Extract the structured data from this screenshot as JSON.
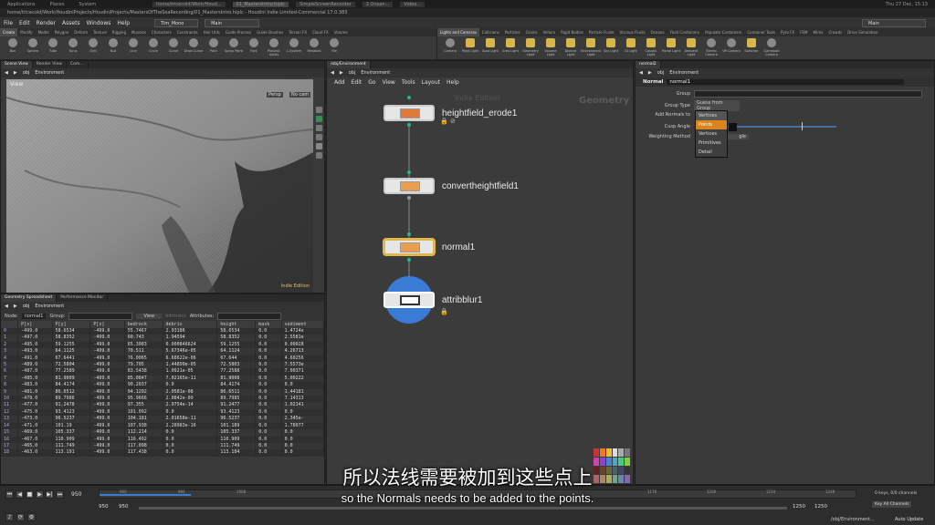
{
  "os_bar": {
    "items": [
      "Applications",
      "Places",
      "System"
    ],
    "tasks": [
      "home/tricecold/Work/Houd...",
      "01_MastersIntro.hiplc",
      "SimpleScreenRecorder",
      "2.Ocean...",
      "Video..."
    ],
    "clock": "Thu 27 Dec, 15:13"
  },
  "window_title": "home/tricecold/Work/HoudiniProjects/HoudiniProjects/MastersOfTheSeaRecording/01_MastersIntro.hiplc - Houdini Indie Limited-Commercial 17.0.383",
  "menu": {
    "items": [
      "File",
      "Edit",
      "Render",
      "Assets",
      "Windows",
      "Help"
    ],
    "desktop": "Tim_Mono",
    "pane": "Main",
    "right_pane": "Main"
  },
  "shelf_left": {
    "tabs": [
      "Create",
      "Modify",
      "Model",
      "Polygon",
      "Deform",
      "Texture",
      "Rigging",
      "Muscles",
      "Characters",
      "Constraints",
      "Hair Utils",
      "Guide Process",
      "Guide Brushes",
      "Terrain FX",
      "Cloud FX",
      "Volume"
    ],
    "tools": [
      "Box",
      "Sphere",
      "Tube",
      "Torus",
      "Grid",
      "Null",
      "Line",
      "Circle",
      "Curve",
      "Draw Curve",
      "Path",
      "Spray Paint",
      "Font",
      "Platonic Solids",
      "L-System",
      "Metaball",
      "File"
    ]
  },
  "shelf_right": {
    "tabs": [
      "Lights and Cameras",
      "Collisions",
      "Particles",
      "Grains",
      "Vellum",
      "Rigid Bodies",
      "Particle Fluids",
      "Viscous Fluids",
      "Oceans",
      "Fluid Containers",
      "Populate Containers",
      "Container Tools",
      "Pyro FX",
      "FEM",
      "Wires",
      "Crowds",
      "Drive Simulation"
    ],
    "tools": [
      "Camera",
      "Point Light",
      "Spot Light",
      "Area Light",
      "Geometry Light",
      "Volume Light",
      "Distant Light",
      "Environment Light",
      "Sky Light",
      "GI Light",
      "Caustic Light",
      "Portal Light",
      "Ambient Light",
      "Stereo Camera",
      "VR Camera",
      "Switcher",
      "Gamepad Camera"
    ]
  },
  "scene_view": {
    "tabs": [
      "Scene View",
      "Render View",
      "Com..."
    ],
    "path": "obj",
    "node": "Environment",
    "view_label": "View",
    "persp": "Persp",
    "cam": "No cam",
    "watermark": "Indie Edition"
  },
  "spreadsheet": {
    "tabs": [
      "Geometry Spreadsheet",
      "Performance Monitor"
    ],
    "path": "obj",
    "node_path": "Environment",
    "node_label": "Node:",
    "node_value": "normal1",
    "group_label": "Group:",
    "view_label": "View",
    "intrinsics": "Intrinsics",
    "attributes_label": "Attributes:",
    "columns": [
      "",
      "P[x]",
      "P[y]",
      "P[z]",
      "bedrock",
      "debris",
      "height",
      "mask",
      "sediment"
    ],
    "rows": [
      [
        "0",
        "-499.0",
        "58.6534",
        "-499.0",
        "55.7467",
        "2.93186",
        "58.6534",
        "0.0",
        "1.4724e"
      ],
      [
        "1",
        "-497.0",
        "58.8352",
        "-499.0",
        "60.743",
        "1.94594",
        "58.8352",
        "0.0",
        "2.5581e"
      ],
      [
        "2",
        "-495.0",
        "59.1255",
        "-499.0",
        "65.3083",
        "0.000846624",
        "59.1255",
        "0.0",
        "0.00028"
      ],
      [
        "3",
        "-493.0",
        "64.1125",
        "-499.0",
        "70.511",
        "5.67346e-05",
        "64.1124",
        "0.0",
        "4.26713"
      ],
      [
        "4",
        "-491.0",
        "67.6441",
        "-499.0",
        "76.0065",
        "6.68622e-06",
        "67.644",
        "0.0",
        "4.60256"
      ],
      [
        "5",
        "-489.0",
        "72.5804",
        "-499.0",
        "79.705",
        "1.44899e-05",
        "72.5803",
        "0.0",
        "7.5573e"
      ],
      [
        "6",
        "-487.0",
        "77.2589",
        "-499.0",
        "83.5438",
        "1.0921e-05",
        "77.2588",
        "0.0",
        "7.00371"
      ],
      [
        "7",
        "-485.0",
        "81.9009",
        "-499.0",
        "85.0847",
        "7.02165e-11",
        "81.9008",
        "0.0",
        "5.00222"
      ],
      [
        "8",
        "-483.0",
        "84.4174",
        "-499.0",
        "90.2037",
        "0.0",
        "84.4174",
        "0.0",
        "0.0"
      ],
      [
        "9",
        "-481.0",
        "86.6512",
        "-499.0",
        "94.1292",
        "2.0581e-08",
        "86.6511",
        "0.0",
        "1.44181"
      ],
      [
        "10",
        "-479.0",
        "89.7986",
        "-499.0",
        "95.9666",
        "2.0842e-09",
        "89.7985",
        "0.0",
        "7.14313"
      ],
      [
        "11",
        "-477.0",
        "91.2478",
        "-499.0",
        "97.355",
        "2.9754e-14",
        "91.2477",
        "0.0",
        "1.02141"
      ],
      [
        "12",
        "-475.0",
        "93.4123",
        "-499.0",
        "101.092",
        "0.0",
        "93.4123",
        "0.0",
        "0.0"
      ],
      [
        "13",
        "-473.0",
        "96.5237",
        "-499.0",
        "104.181",
        "2.01658e-11",
        "96.5237",
        "0.0",
        "2.345e-"
      ],
      [
        "14",
        "-471.0",
        "101.19",
        "-499.0",
        "107.938",
        "2.28983e-16",
        "101.189",
        "0.0",
        "1.78077"
      ],
      [
        "15",
        "-469.0",
        "105.337",
        "-499.0",
        "112.214",
        "0.0",
        "105.337",
        "0.0",
        "0.0"
      ],
      [
        "16",
        "-467.0",
        "110.909",
        "-499.0",
        "116.492",
        "0.0",
        "110.909",
        "0.0",
        "0.0"
      ],
      [
        "17",
        "-465.0",
        "111.749",
        "-499.0",
        "117.098",
        "0.0",
        "111.749",
        "0.0",
        "0.0"
      ],
      [
        "18",
        "-463.0",
        "113.191",
        "-499.0",
        "117.438",
        "0.0",
        "113.184",
        "0.0",
        "0.0"
      ]
    ]
  },
  "network": {
    "tabs": [
      "/obj/Environment"
    ],
    "path": "obj",
    "node": "Environment",
    "menus": [
      "Add",
      "Edit",
      "Go",
      "View",
      "Tools",
      "Layout",
      "Help"
    ],
    "watermark": "Indie Edition",
    "context": "Geometry",
    "nodes": [
      {
        "name": "heightfield_erode1"
      },
      {
        "name": "convertheightfield1"
      },
      {
        "name": "normal1"
      },
      {
        "name": "attribblur1"
      }
    ]
  },
  "params": {
    "tabs": [
      "normal2"
    ],
    "path": "obj",
    "node": "Environment",
    "node_type": "Normal",
    "node_name": "normal1",
    "group_label": "Group",
    "group_type_label": "Group Type",
    "group_type_value": "Guess from Group",
    "add_normals_label": "Add Normals to",
    "cusp_label": "Cusp Angle",
    "weighting_label": "Weighting Method",
    "weighting_partial": "gle",
    "dropdown_options": [
      "Vertices",
      "Points",
      "Vertices",
      "Primitives",
      "Detail"
    ],
    "dropdown_highlight": 1
  },
  "timeline": {
    "frame": "950",
    "start": "950",
    "start2": "950",
    "end": "1250",
    "end2": "1250",
    "ticks": [
      "960",
      "984",
      "1008",
      "1176",
      "1200",
      "1224",
      "1248"
    ],
    "keys": "0 keys, 0/0 channels",
    "key_all": "Key All Channels",
    "path": "/obj/Environment...",
    "auto_update": "Auto Update"
  },
  "subtitle": {
    "cn": "所以法线需要被加到这些点上",
    "en": "so the Normals needs to be added to the points."
  },
  "colors": {
    "accent_orange": "#d9841e",
    "node_blue": "#3a7bd5",
    "wire": "#1dbb8e",
    "node_yellow": "#e0b84a"
  }
}
